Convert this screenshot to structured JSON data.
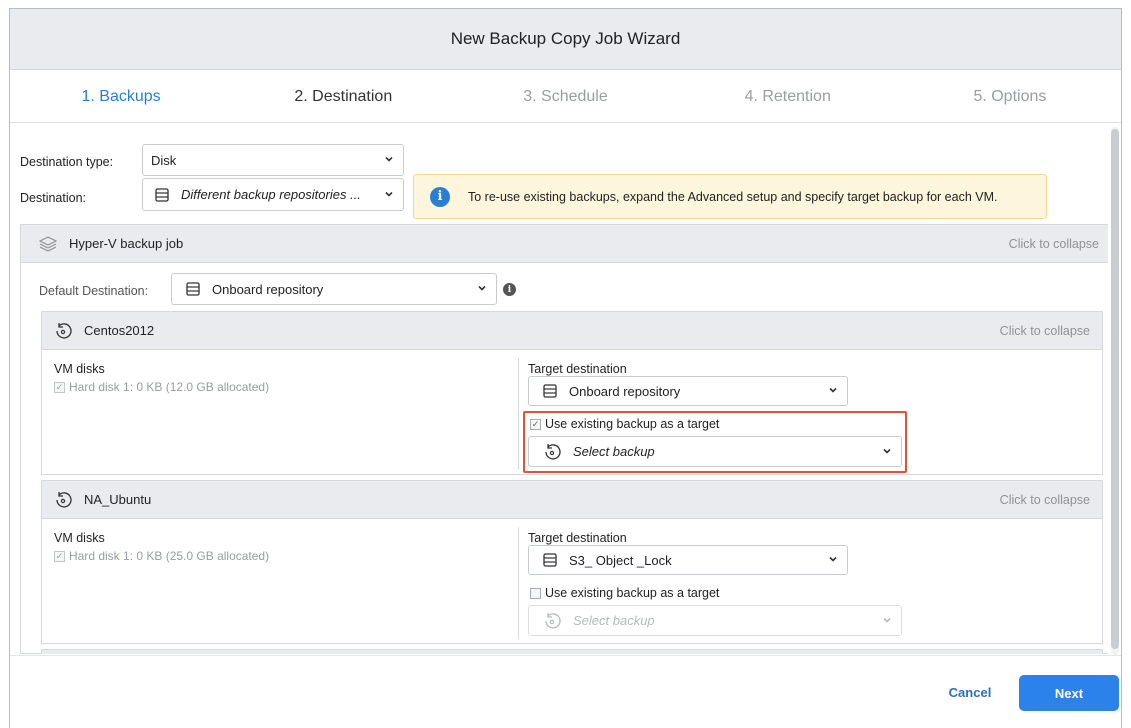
{
  "window": {
    "title": "New Backup Copy Job Wizard"
  },
  "steps": [
    {
      "label": "1. Backups",
      "state": "completed"
    },
    {
      "label": "2. Destination",
      "state": "current"
    },
    {
      "label": "3. Schedule",
      "state": "upcoming"
    },
    {
      "label": "4. Retention",
      "state": "upcoming"
    },
    {
      "label": "5. Options",
      "state": "upcoming"
    }
  ],
  "destination": {
    "type_label": "Destination type:",
    "type_value": "Disk",
    "dest_label": "Destination:",
    "dest_value": "Different backup repositories ..."
  },
  "info_banner": {
    "icon": "info-icon",
    "text": "To re-use existing backups, expand the Advanced setup and specify target backup for each VM."
  },
  "job": {
    "title": "Hyper-V backup job",
    "collapse_label": "Click to collapse",
    "default_dest_label": "Default Destination:",
    "default_dest_value": "Onboard repository"
  },
  "vms": [
    {
      "name": "Centos2012",
      "collapse_label": "Click to collapse",
      "disks_label": "VM disks",
      "disk": "Hard disk 1: 0 KB (12.0 GB allocated)",
      "target_label": "Target destination",
      "target_value": "Onboard repository",
      "use_existing_label": "Use existing backup as a target",
      "use_existing_checked": true,
      "select_backup_placeholder": "Select backup"
    },
    {
      "name": "NA_Ubuntu",
      "collapse_label": "Click to collapse",
      "disks_label": "VM disks",
      "disk": "Hard disk 1: 0 KB (25.0 GB allocated)",
      "target_label": "Target destination",
      "target_value": "S3_ Object _Lock",
      "use_existing_label": "Use existing backup as a target",
      "use_existing_checked": false,
      "select_backup_placeholder": "Select backup"
    }
  ],
  "footer": {
    "cancel_label": "Cancel",
    "next_label": "Next"
  },
  "colors": {
    "accent": "#2a82ea",
    "highlight": "#e2523a",
    "banner_bg": "#fdf5dc"
  }
}
